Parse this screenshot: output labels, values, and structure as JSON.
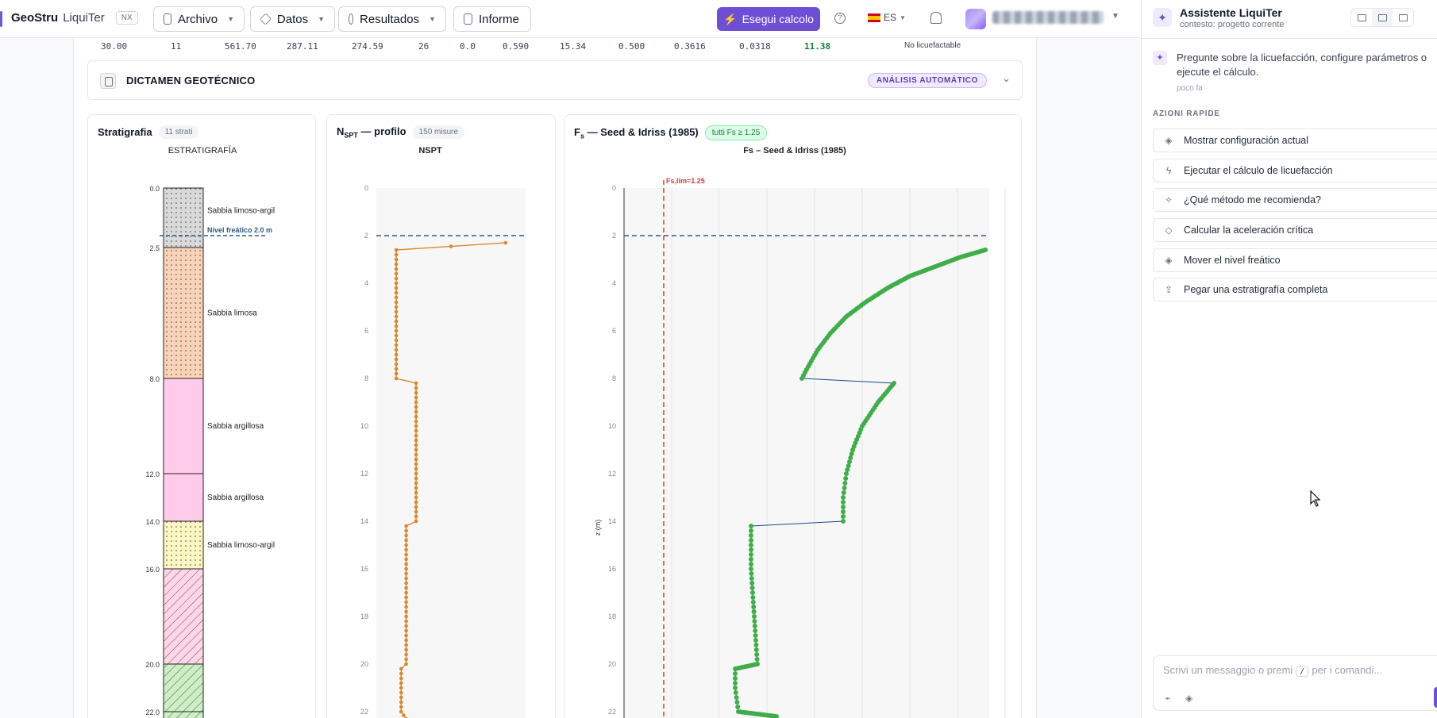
{
  "app": {
    "brand": "GeoStru",
    "product": "LiquiTer",
    "badge": "NX"
  },
  "toolbar": {
    "menus": [
      {
        "label": "Archivo"
      },
      {
        "label": "Datos"
      },
      {
        "label": "Resultados"
      },
      {
        "label": "Informe"
      }
    ],
    "run_label": "Esegui calcolo",
    "language": "ES"
  },
  "summary_row": {
    "values": [
      "30.00",
      "11",
      "561.70",
      "287.11",
      "274.59",
      "26",
      "0.0",
      "0.590",
      "15.34",
      "0.500",
      "0.3616",
      "0.0318",
      "11.38"
    ],
    "status": "No licuefactable"
  },
  "dictamen": {
    "title": "DICTAMEN GEOTÉCNICO",
    "badge": "ANÁLISIS AUTOMÁTICO"
  },
  "strat_card": {
    "title": "Stratigrafia",
    "chip": "11 strati",
    "chart_title": "ESTRATIGRAFÍA",
    "water_label": "Nivel freático 2.0 m",
    "water_depth": 2.0,
    "layers": [
      {
        "top": 0.0,
        "bottom": 2.5,
        "label": "Sabbia limoso-argil",
        "fill": "#d9d9d9",
        "pattern": "dots"
      },
      {
        "top": 2.5,
        "bottom": 8.0,
        "label": "Sabbia limosa",
        "fill": "#f9d3b8",
        "pattern": "dots"
      },
      {
        "top": 8.0,
        "bottom": 12.0,
        "label": "Sabbia argillosa",
        "fill": "#ffcbea",
        "pattern": "none"
      },
      {
        "top": 12.0,
        "bottom": 14.0,
        "label": "Sabbia argillosa",
        "fill": "#ffcbea",
        "pattern": "none"
      },
      {
        "top": 14.0,
        "bottom": 16.0,
        "label": "Sabbia limoso-argil",
        "fill": "#fdf7c3",
        "pattern": "dots"
      },
      {
        "top": 16.0,
        "bottom": 20.0,
        "label": "",
        "fill": "#ffd6e7",
        "pattern": "hatch"
      },
      {
        "top": 20.0,
        "bottom": 22.0,
        "label": "",
        "fill": "#ccefc4",
        "pattern": "hatch"
      },
      {
        "top": 22.0,
        "bottom": 23.0,
        "label": "",
        "fill": "#ccefc4",
        "pattern": "hatch"
      }
    ],
    "depth_ticks": [
      "0.0",
      "2.5",
      "8.0",
      "12.0",
      "14.0",
      "16.0",
      "20.0",
      "22.0"
    ]
  },
  "nspt_card": {
    "title": "NSPT — profilo",
    "title_main": "N",
    "title_sub": "SPT",
    "title_rest": " — profilo",
    "chip": "150 misure",
    "chart_title": "NSPT"
  },
  "fs_card": {
    "title_main": "F",
    "title_sub": "s",
    "title_rest": " — Seed & Idriss (1985)",
    "chip": "tutti Fs ≥ 1.25",
    "chart_title": "Fs – Seed & Idriss (1985)",
    "limit_label": "Fs,lim=1.25",
    "ylabel": "z (m)"
  },
  "chart_data": [
    {
      "type": "line",
      "title": "NSPT",
      "ylabel": "",
      "ylim": [
        0,
        23
      ],
      "y_ticks": [
        0,
        2,
        4,
        6,
        8,
        10,
        12,
        14,
        16,
        18,
        20,
        22
      ],
      "water_depth": 2.0,
      "series": [
        {
          "points": [
            [
              26,
              2.3
            ],
            [
              4,
              2.6
            ],
            [
              4,
              8.0
            ],
            [
              8,
              8.2
            ],
            [
              8,
              14.0
            ],
            [
              6,
              14.2
            ],
            [
              6,
              20.0
            ],
            [
              5,
              20.2
            ],
            [
              5,
              22.0
            ],
            [
              6,
              22.3
            ],
            [
              6,
              23.0
            ]
          ]
        }
      ]
    },
    {
      "type": "scatter",
      "title": "Fs – Seed & Idriss (1985)",
      "ylabel": "z (m)",
      "ylim": [
        0,
        23
      ],
      "y_ticks": [
        0,
        2,
        4,
        6,
        8,
        10,
        12,
        14,
        16,
        18,
        20,
        22
      ],
      "limit_line": 1.25,
      "water_depth": 2.0,
      "series": [
        {
          "points": [
            [
              11.38,
              2.6
            ],
            [
              10.6,
              2.9
            ],
            [
              9.8,
              3.3
            ],
            [
              9.0,
              3.7
            ],
            [
              8.3,
              4.2
            ],
            [
              7.6,
              4.8
            ],
            [
              7.0,
              5.4
            ],
            [
              6.5,
              6.1
            ],
            [
              6.1,
              6.8
            ],
            [
              5.8,
              7.5
            ],
            [
              5.6,
              8.0
            ],
            [
              8.5,
              8.2
            ],
            [
              8.0,
              9.0
            ],
            [
              7.5,
              10.0
            ],
            [
              7.2,
              11.0
            ],
            [
              7.0,
              12.0
            ],
            [
              6.9,
              13.0
            ],
            [
              6.9,
              14.0
            ],
            [
              4.0,
              14.2
            ],
            [
              4.0,
              16.0
            ],
            [
              4.1,
              18.0
            ],
            [
              4.2,
              20.0
            ],
            [
              3.5,
              20.2
            ],
            [
              3.5,
              21.0
            ],
            [
              3.6,
              22.0
            ],
            [
              4.8,
              22.2
            ],
            [
              4.9,
              23.0
            ]
          ]
        }
      ]
    }
  ],
  "assistant": {
    "title": "Assistente LiquiTer",
    "subtitle": "contesto: progetto corrente",
    "message": "Pregunte sobre la licuefacción, configure parámetros o ejecute el cálculo.",
    "time": "poco fa",
    "quick_label": "AZIONI RAPIDE",
    "quick_actions": [
      {
        "label": "Mostrar configuración actual",
        "icon": "layers-icon"
      },
      {
        "label": "Ejecutar el cálculo de licuefacción",
        "icon": "bolt-icon"
      },
      {
        "label": "¿Qué método me recomienda?",
        "icon": "sparkle-icon"
      },
      {
        "label": "Calcular la aceleración crítica",
        "icon": "diamond-icon"
      },
      {
        "label": "Mover el nivel freático",
        "icon": "layers-icon"
      },
      {
        "label": "Pegar una estratigrafía completa",
        "icon": "upload-icon"
      }
    ],
    "input_placeholder_a": "Scrivi un messaggio o premi",
    "input_key": "/",
    "input_placeholder_b": "per i comandi..."
  },
  "colors": {
    "accent": "#6d4fd6",
    "nspt_series": "#d9892b",
    "fs_series": "#3fae49",
    "fs_link": "#1f4e8c",
    "limit": "#d13b3b",
    "water": "#2c5a85"
  }
}
